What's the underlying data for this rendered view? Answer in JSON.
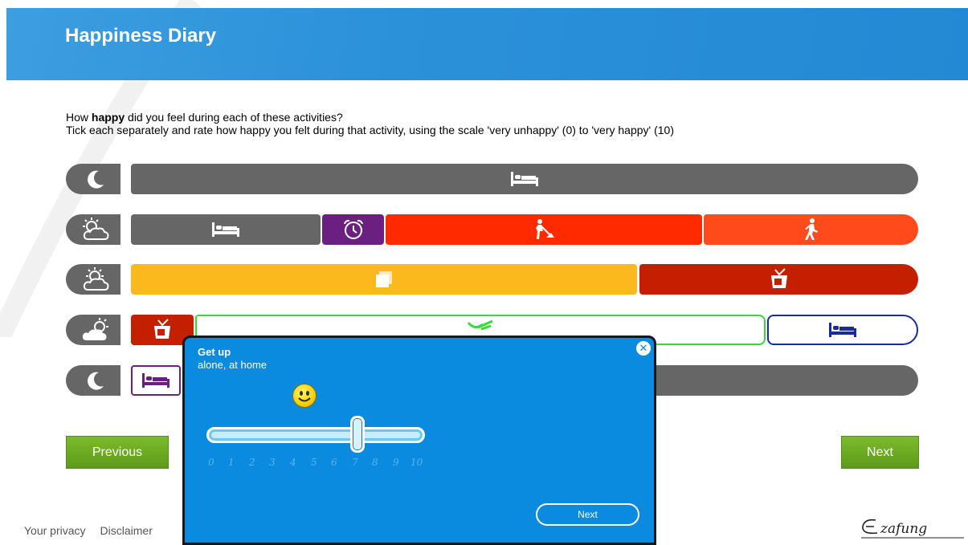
{
  "header": {
    "title": "Happiness Diary"
  },
  "instructions": {
    "line1_before": "How ",
    "line1_bold": "happy",
    "line1_after": " did you feel during each of these activities?",
    "line2": "Tick each separately and rate how happy you felt during that activity, using the scale 'very unhappy' (0) to 'very happy' (10)"
  },
  "colors": {
    "grey": "#666666",
    "purple": "#6b2081",
    "red": "#ff2a00",
    "orange_red": "#ff4a1c",
    "yellow": "#fcb91e",
    "dark_red": "#c42000",
    "green_outline": "#33dd33",
    "navy": "#1a2aa0",
    "header_blue": "#2b91d9",
    "popup_blue": "#0b8be0",
    "button_green": "#6aaa22"
  },
  "rows": [
    {
      "period_icon": "moon-icon",
      "activities": [
        "sleep-icon"
      ]
    },
    {
      "period_icon": "sunrise-cloud-icon",
      "activities": [
        "sleep-icon",
        "alarm-clock-icon",
        "work-icon",
        "walking-icon"
      ]
    },
    {
      "period_icon": "sun-cloud-icon",
      "activities": [
        "paper-icon",
        "tv-icon"
      ]
    },
    {
      "period_icon": "sunset-cloud-icon",
      "activities": [
        "tv-icon",
        "cooking-icon",
        "sleep-icon"
      ]
    },
    {
      "period_icon": "moon-icon",
      "activities": [
        "sleep-icon"
      ]
    }
  ],
  "nav": {
    "previous": "Previous",
    "next": "Next"
  },
  "footer": {
    "privacy": "Your privacy",
    "disclaimer": "Disclaimer",
    "logo_text": "Ezafung"
  },
  "popup": {
    "title": "Get up",
    "subtitle": "alone, at home",
    "close_icon": "close-icon",
    "mood_icon": "smiley-icon",
    "rating": 7,
    "scale_min": 0,
    "scale_max": 10,
    "ticks": [
      "0",
      "1",
      "2",
      "3",
      "4",
      "5",
      "6",
      "7",
      "8",
      "9",
      "10"
    ],
    "next": "Next"
  }
}
